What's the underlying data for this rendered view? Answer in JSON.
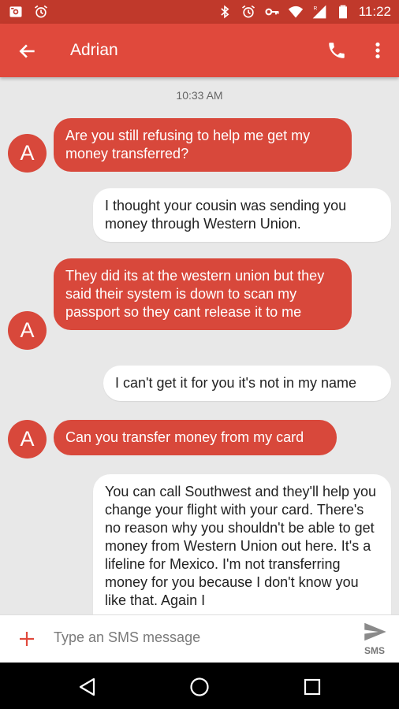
{
  "status_bar": {
    "time": "11:22",
    "left_icons": [
      "photo-notification-icon",
      "alarm-icon"
    ],
    "right_icons": [
      "bluetooth-icon",
      "alarm-icon",
      "vpn-key-icon",
      "wifi-icon",
      "signal-icon",
      "battery-icon"
    ],
    "signal_label": "R"
  },
  "app_bar": {
    "title": "Adrian",
    "icons": [
      "back-arrow-icon",
      "phone-icon",
      "more-vert-icon"
    ]
  },
  "conversation": {
    "timestamp": "10:33 AM",
    "avatar_initial": "A",
    "messages": [
      {
        "direction": "incoming",
        "text": "Are you still refusing to help me get my money transferred?"
      },
      {
        "direction": "outgoing",
        "text": "I thought your cousin was sending you money through Western Union."
      },
      {
        "direction": "incoming",
        "text": "They did its at the western union but they said their system is down to scan my passport so they cant release it to me"
      },
      {
        "direction": "outgoing",
        "text": "I can't get it for you it's not in my name"
      },
      {
        "direction": "incoming",
        "text": "Can you transfer money from my card"
      },
      {
        "direction": "outgoing",
        "text": "You can call Southwest and they'll help you change your flight with your card. There's no reason why you shouldn't be able to get money from Western Union out here. It's a lifeline for Mexico. I'm not transferring money for you because I don't know you like that. Again I"
      }
    ]
  },
  "composer": {
    "placeholder": "Type an SMS message",
    "send_label": "SMS",
    "icons": [
      "add-icon",
      "send-icon"
    ]
  },
  "nav_bar": {
    "icons": [
      "back-triangle-icon",
      "home-circle-icon",
      "recents-square-icon"
    ]
  },
  "colors": {
    "status_bar": "#c0392b",
    "app_bar": "#e0493c",
    "incoming_bubble": "#d8483b",
    "outgoing_bubble": "#ffffff",
    "background": "#e8e8e8"
  }
}
